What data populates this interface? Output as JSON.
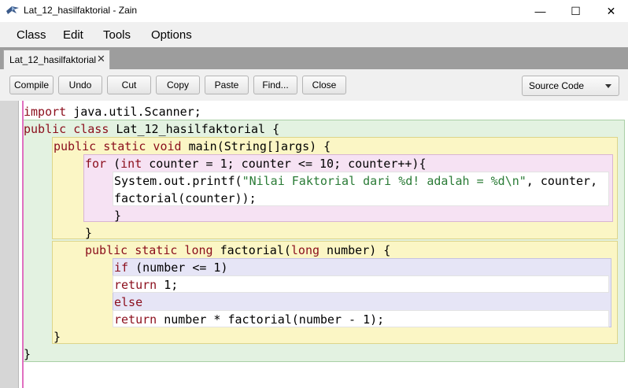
{
  "window": {
    "title": "Lat_12_hasilfaktorial - Zain",
    "controls": {
      "minimize": "—",
      "maximize": "☐",
      "close": "✕"
    }
  },
  "menu": [
    "Class",
    "Edit",
    "Tools",
    "Options"
  ],
  "tab": {
    "label": "Lat_12_hasilfaktorial",
    "close": "✕"
  },
  "toolbar": {
    "buttons": [
      "Compile",
      "Undo",
      "Cut",
      "Copy",
      "Paste",
      "Find...",
      "Close"
    ],
    "view_select": "Source Code"
  },
  "code": {
    "lines": [
      [
        {
          "t": "import",
          "k": "kw"
        },
        {
          "t": " java.util.Scanner;"
        }
      ],
      [
        {
          "t": "public class",
          "k": "kw"
        },
        {
          "t": " Lat_12_hasilfaktorial {"
        }
      ],
      [
        {
          "t": "public static void",
          "k": "kw"
        },
        {
          "t": " main(String[]args) {"
        }
      ],
      [
        {
          "t": "for",
          "k": "kw"
        },
        {
          "t": " ("
        },
        {
          "t": "int",
          "k": "kw"
        },
        {
          "t": " counter = 1; counter <= 10; counter++){"
        }
      ],
      [
        {
          "t": "System.out.printf("
        },
        {
          "t": "\"Nilai Faktorial dari %d! adalah = %d\\n\"",
          "k": "str"
        },
        {
          "t": ", counter,"
        }
      ],
      [
        {
          "t": "factorial(counter));"
        }
      ],
      [
        {
          "t": "}"
        }
      ],
      [
        {
          "t": "}"
        }
      ],
      [
        {
          "t": "public static long",
          "k": "kw"
        },
        {
          "t": " factorial("
        },
        {
          "t": "long",
          "k": "kw"
        },
        {
          "t": " number) {"
        }
      ],
      [
        {
          "t": "if",
          "k": "kw"
        },
        {
          "t": " (number <= 1)"
        }
      ],
      [
        {
          "t": "return",
          "k": "kw"
        },
        {
          "t": " 1;"
        }
      ],
      [
        {
          "t": "else",
          "k": "kw"
        }
      ],
      [
        {
          "t": "return",
          "k": "kw"
        },
        {
          "t": " number * factorial(number - 1);"
        }
      ],
      [
        {
          "t": "}"
        }
      ],
      [
        {
          "t": "}"
        }
      ]
    ]
  },
  "colors": {
    "keyword": "#8b0e1c",
    "string": "#2a7b36",
    "class_scope": "#e3f2e1",
    "method_scope": "#fbf6c5",
    "loop_scope": "#f6e2f3",
    "if_scope": "#e6e5f6"
  },
  "icons": {
    "app": "bluej-bird-icon"
  }
}
